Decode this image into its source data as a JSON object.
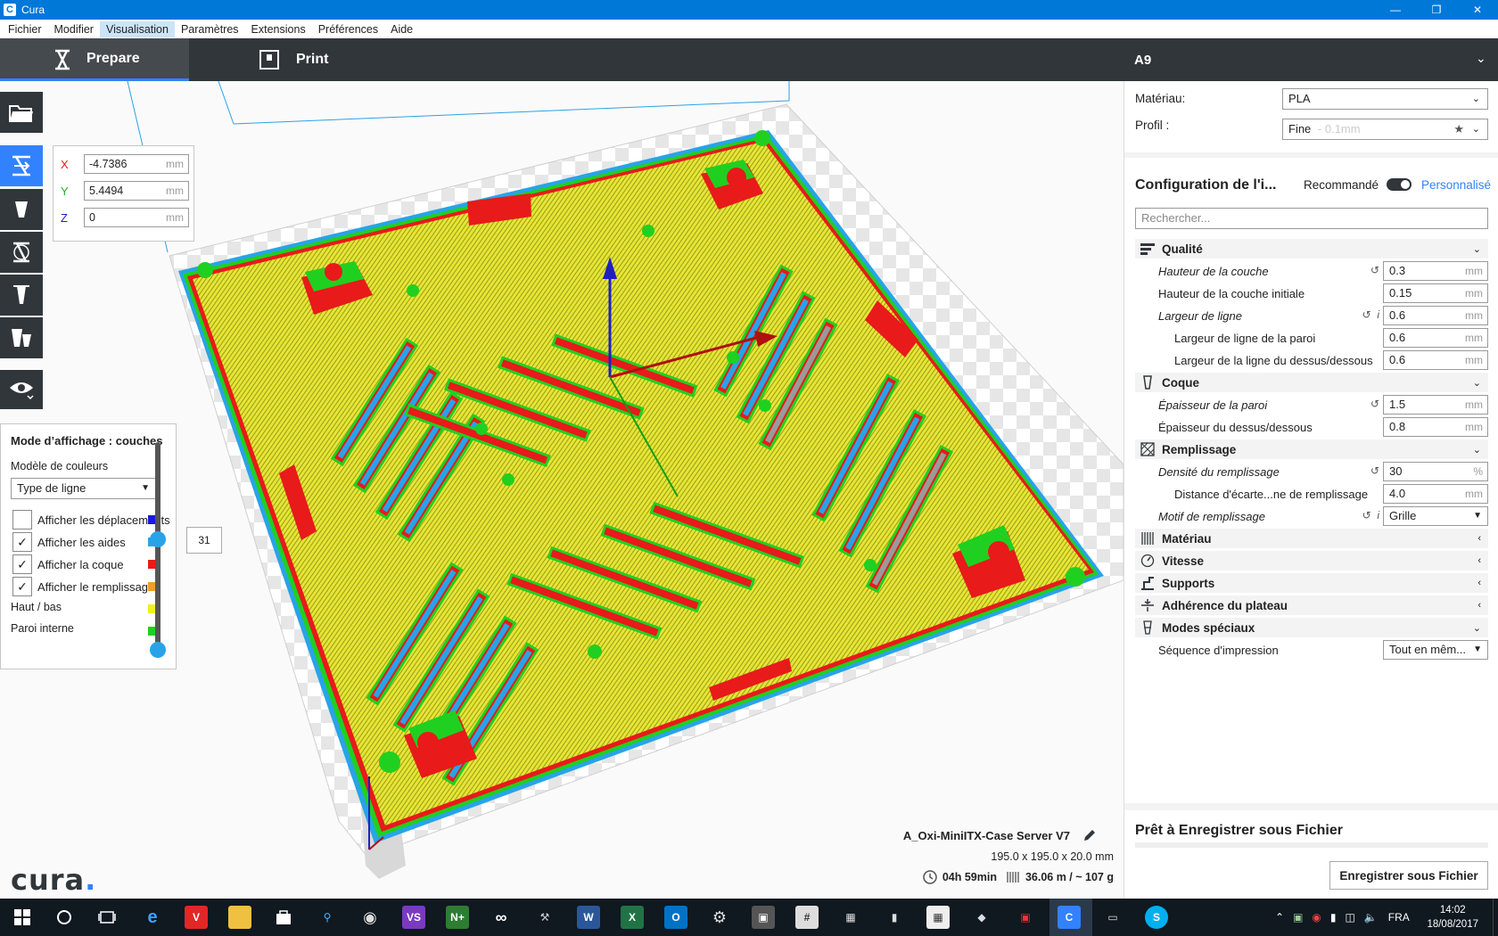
{
  "window": {
    "title": "Cura"
  },
  "menubar": [
    "Fichier",
    "Modifier",
    "Visualisation",
    "Paramètres",
    "Extensions",
    "Préférences",
    "Aide"
  ],
  "header": {
    "tab_prepare": "Prepare",
    "tab_print": "Print",
    "printer": "A9"
  },
  "move_panel": {
    "x_label": "X",
    "x_value": "-4.7386",
    "y_label": "Y",
    "y_value": "5.4494",
    "z_label": "Z",
    "z_value": "0",
    "unit": "mm"
  },
  "view_panel": {
    "title": "Mode d’affichage : couches",
    "color_model_label": "Modèle de couleurs",
    "color_model_value": "Type de ligne",
    "show_travel": "Afficher les déplacements",
    "show_helpers": "Afficher les aides",
    "show_shell": "Afficher la coque",
    "show_infill": "Afficher le remplissage",
    "top_bottom": "Haut / bas",
    "inner_wall": "Paroi interne",
    "layer_number": "31",
    "colors": {
      "travel": "#1a1ad6",
      "helpers": "#29a3e8",
      "shell": "#e81a1a",
      "infill": "#f0a020",
      "top_bottom": "#f0f020",
      "inner_wall": "#20d020"
    }
  },
  "logo": {
    "text": "cura",
    "dot": "."
  },
  "job": {
    "name": "A_Oxi-MiniITX-Case Server V7",
    "dims": "195.0 x 195.0 x 20.0 mm",
    "time": "04h 59min",
    "material": "36.06 m / ~ 107 g"
  },
  "sidebar": {
    "material_label": "Matériau:",
    "material_value": "PLA",
    "profile_label": "Profil :",
    "profile_value": "Fine",
    "profile_hint": "- 0.1mm",
    "config_title": "Configuration de l'i...",
    "recommended": "Recommandé",
    "custom": "Personnalisé",
    "search_placeholder": "Rechercher...",
    "categories": {
      "quality": "Qualité",
      "shell": "Coque",
      "infill": "Remplissage",
      "material": "Matériau",
      "speed": "Vitesse",
      "supports": "Supports",
      "adhesion": "Adhérence du plateau",
      "special": "Modes spéciaux"
    },
    "settings": {
      "layer_height": {
        "label": "Hauteur de la couche",
        "value": "0.3",
        "unit": "mm"
      },
      "initial_layer_height": {
        "label": "Hauteur de la couche initiale",
        "value": "0.15",
        "unit": "mm"
      },
      "line_width": {
        "label": "Largeur de ligne",
        "value": "0.6",
        "unit": "mm"
      },
      "wall_line_width": {
        "label": "Largeur de ligne de la paroi",
        "value": "0.6",
        "unit": "mm"
      },
      "top_bottom_line_width": {
        "label": "Largeur de la ligne du dessus/dessous",
        "value": "0.6",
        "unit": "mm"
      },
      "wall_thickness": {
        "label": "Épaisseur de la paroi",
        "value": "1.5",
        "unit": "mm"
      },
      "top_bottom_thickness": {
        "label": "Épaisseur du dessus/dessous",
        "value": "0.8",
        "unit": "mm"
      },
      "infill_density": {
        "label": "Densité du remplissage",
        "value": "30",
        "unit": "%"
      },
      "infill_line_distance": {
        "label": "Distance d'écarte...ne de remplissage",
        "value": "4.0",
        "unit": "mm"
      },
      "infill_pattern": {
        "label": "Motif de remplissage",
        "value": "Grille"
      },
      "print_sequence": {
        "label": "Séquence d'impression",
        "value": "Tout en mêm..."
      }
    },
    "ready": "Prêt à Enregistrer sous Fichier",
    "save_button": "Enregistrer sous Fichier"
  },
  "taskbar": {
    "lang": "FRA",
    "time": "14:02",
    "date": "18/08/2017"
  }
}
